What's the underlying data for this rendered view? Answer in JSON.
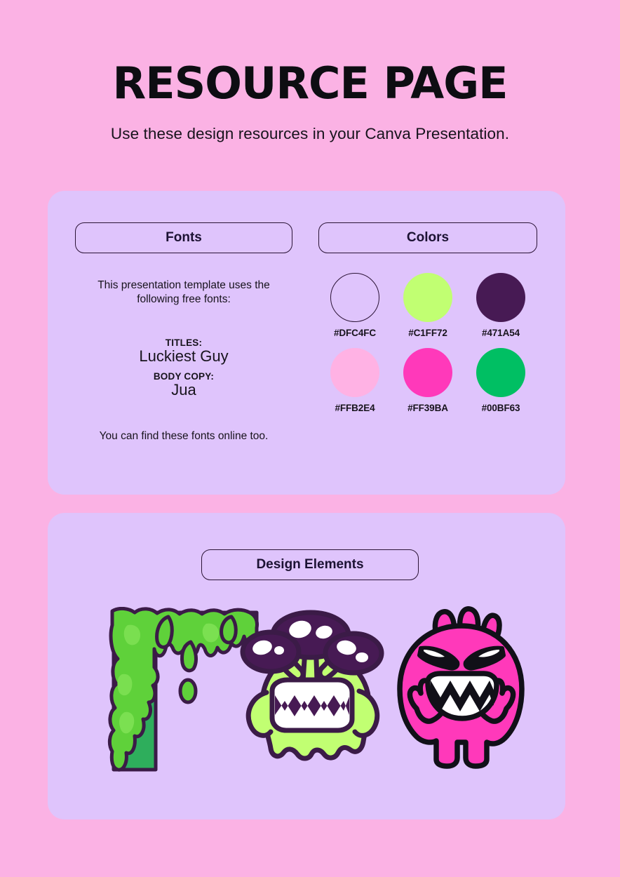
{
  "header": {
    "title": "RESOURCE PAGE",
    "subtitle": "Use these design resources in your Canva Presentation."
  },
  "resources_card": {
    "fonts": {
      "heading": "Fonts",
      "intro": "This presentation template uses the following free fonts:",
      "titles_label": "TITLES:",
      "titles_value": "Luckiest Guy",
      "body_label": "BODY COPY:",
      "body_value": "Jua",
      "outro": "You can find these fonts online too."
    },
    "colors": {
      "heading": "Colors",
      "swatches": [
        {
          "hex": "#DFC4FC",
          "outlined": true
        },
        {
          "hex": "#C1FF72",
          "outlined": false
        },
        {
          "hex": "#471A54",
          "outlined": false
        },
        {
          "hex": "#FFB2E4",
          "outlined": false
        },
        {
          "hex": "#FF39BA",
          "outlined": false
        },
        {
          "hex": "#00BF63",
          "outlined": false
        }
      ]
    }
  },
  "elements_card": {
    "heading": "Design Elements",
    "items": [
      {
        "name": "green-slime-corner-drip"
      },
      {
        "name": "green-mushroom-monster"
      },
      {
        "name": "pink-angry-monster"
      }
    ]
  },
  "theme": {
    "page_background": "#FBB2E4",
    "card_background": "#DFC4FC",
    "outline": "#2B1436",
    "text": "#17131c"
  }
}
